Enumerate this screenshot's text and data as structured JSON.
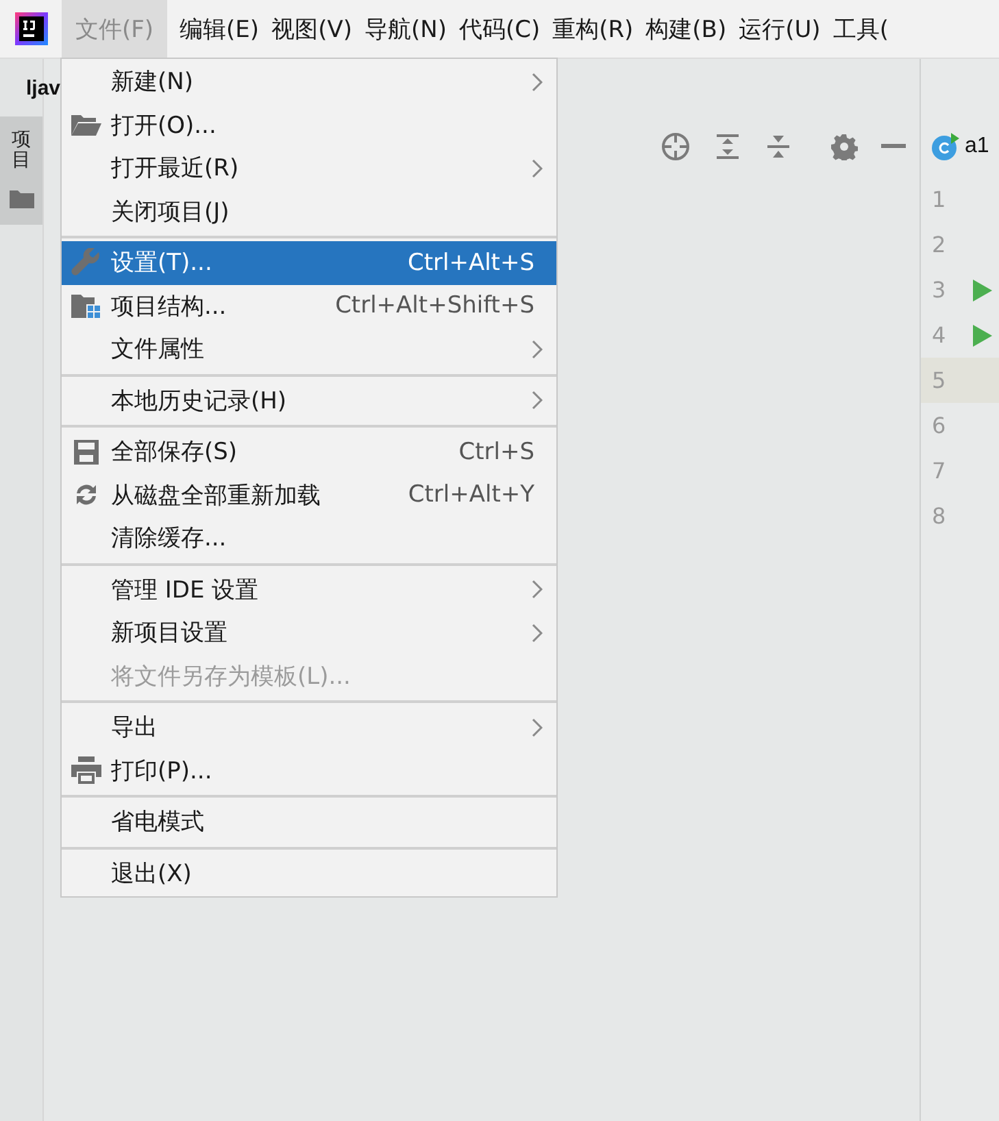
{
  "menubar": {
    "items": [
      {
        "label": "文件(F)",
        "selected": true
      },
      {
        "label": "编辑(E)",
        "selected": false
      },
      {
        "label": "视图(V)",
        "selected": false
      },
      {
        "label": "导航(N)",
        "selected": false
      },
      {
        "label": "代码(C)",
        "selected": false
      },
      {
        "label": "重构(R)",
        "selected": false
      },
      {
        "label": "构建(B)",
        "selected": false
      },
      {
        "label": "运行(U)",
        "selected": false
      },
      {
        "label": "工具(",
        "selected": false
      }
    ]
  },
  "project_title": "ljav",
  "tool_window_tabs": [
    {
      "label": "项目",
      "selected": true
    }
  ],
  "editor": {
    "tab": "a1",
    "lines": [
      {
        "number": "1",
        "run": false,
        "current": false
      },
      {
        "number": "2",
        "run": false,
        "current": false
      },
      {
        "number": "3",
        "run": true,
        "current": false
      },
      {
        "number": "4",
        "run": true,
        "current": false
      },
      {
        "number": "5",
        "run": false,
        "current": true
      },
      {
        "number": "6",
        "run": false,
        "current": false
      },
      {
        "number": "7",
        "run": false,
        "current": false
      },
      {
        "number": "8",
        "run": false,
        "current": false
      }
    ]
  },
  "menu": {
    "groups": [
      [
        {
          "label": "新建(N)",
          "submenu": true,
          "selected": false,
          "disabled": false
        },
        {
          "label": "打开(O)...",
          "kind": "folder",
          "submenu": false,
          "selected": false,
          "disabled": false
        },
        {
          "label": "打开最近(R)",
          "submenu": true,
          "selected": false,
          "disabled": false
        },
        {
          "label": "关闭项目(J)",
          "submenu": false,
          "selected": false,
          "disabled": false
        }
      ],
      [
        {
          "label": "设置(T)...",
          "kind": "wrench",
          "shortcut": "Ctrl+Alt+S",
          "submenu": false,
          "selected": true,
          "disabled": false
        },
        {
          "label": "项目结构...",
          "kind": "structure",
          "shortcut": "Ctrl+Alt+Shift+S",
          "submenu": false,
          "selected": false,
          "disabled": false
        },
        {
          "label": "文件属性",
          "submenu": true,
          "selected": false,
          "disabled": false
        }
      ],
      [
        {
          "label": "本地历史记录(H)",
          "submenu": true,
          "selected": false,
          "disabled": false
        }
      ],
      [
        {
          "label": "全部保存(S)",
          "kind": "save",
          "shortcut": "Ctrl+S",
          "submenu": false,
          "selected": false,
          "disabled": false
        },
        {
          "label": "从磁盘全部重新加载",
          "kind": "reload",
          "shortcut": "Ctrl+Alt+Y",
          "submenu": false,
          "selected": false,
          "disabled": false
        },
        {
          "label": "清除缓存...",
          "submenu": false,
          "selected": false,
          "disabled": false
        }
      ],
      [
        {
          "label": "管理 IDE 设置",
          "submenu": true,
          "selected": false,
          "disabled": false
        },
        {
          "label": "新项目设置",
          "submenu": true,
          "selected": false,
          "disabled": false
        },
        {
          "label": "将文件另存为模板(L)...",
          "submenu": false,
          "selected": false,
          "disabled": true
        }
      ],
      [
        {
          "label": "导出",
          "submenu": true,
          "selected": false,
          "disabled": false
        },
        {
          "label": "打印(P)...",
          "kind": "printer",
          "submenu": false,
          "selected": false,
          "disabled": false
        }
      ],
      [
        {
          "label": "省电模式",
          "submenu": false,
          "selected": false,
          "disabled": false
        }
      ],
      [
        {
          "label": "退出(X)",
          "submenu": false,
          "selected": false,
          "disabled": false
        }
      ]
    ]
  }
}
